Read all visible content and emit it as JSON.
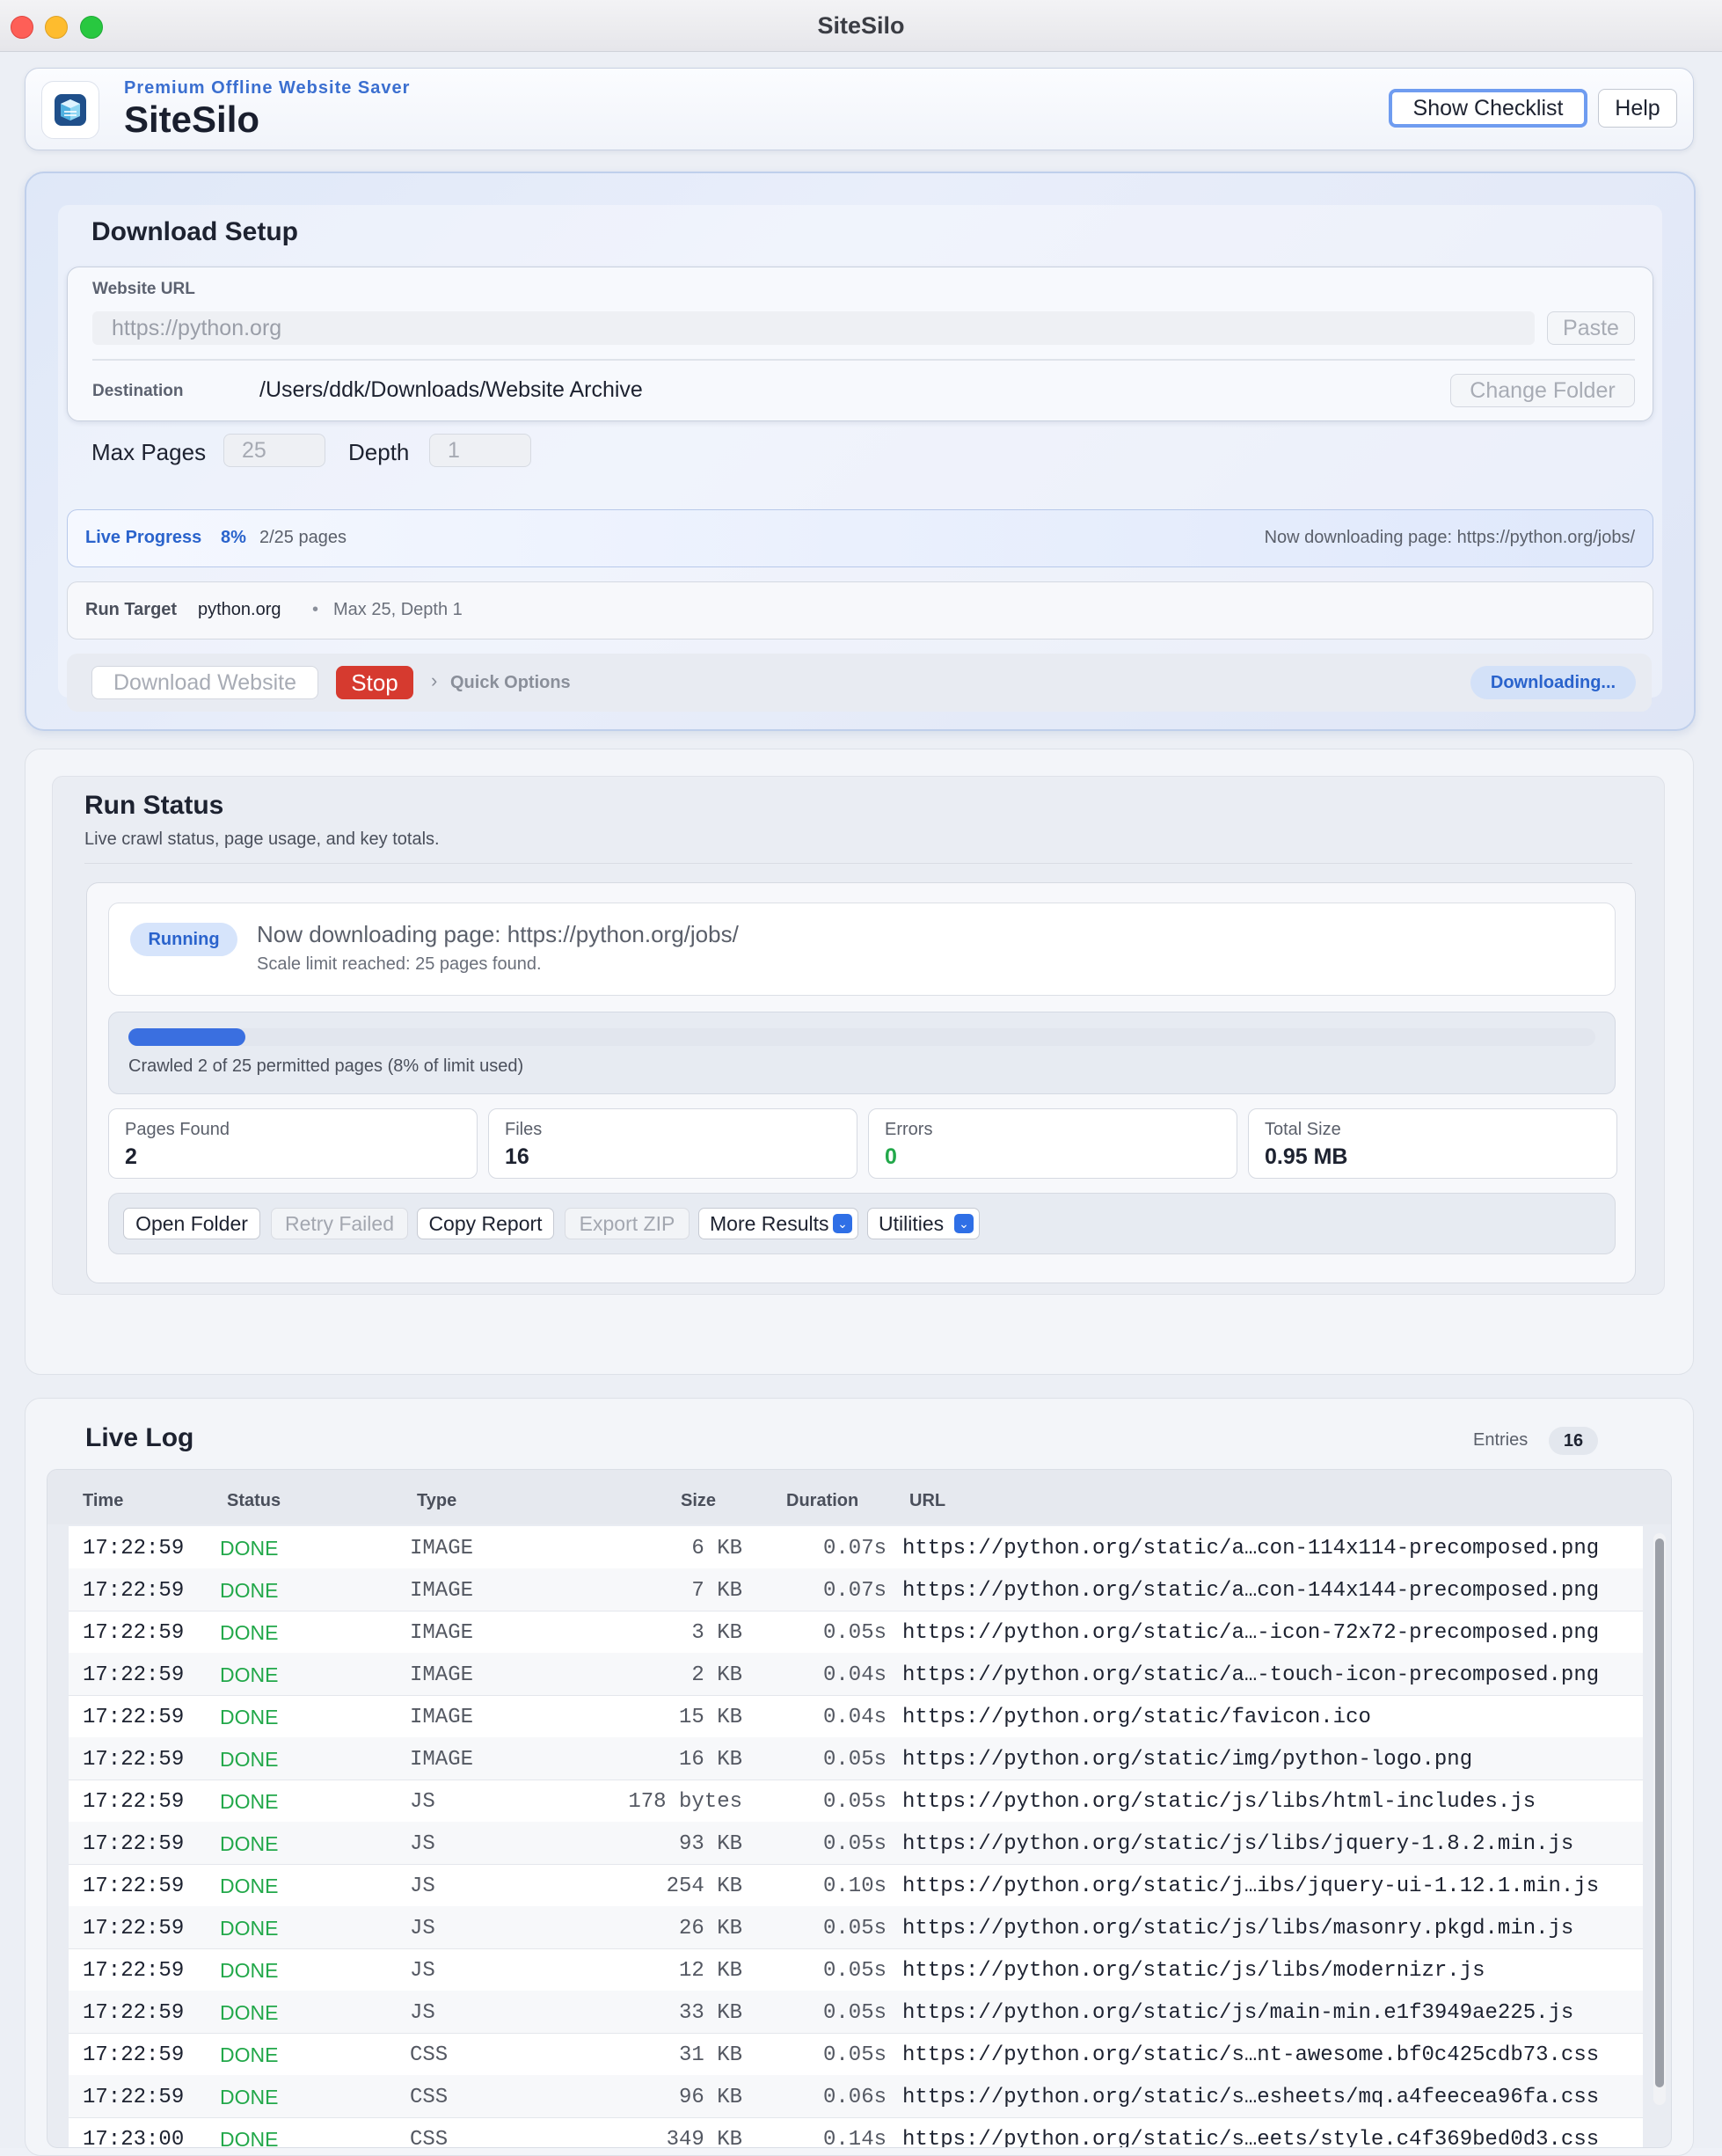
{
  "window": {
    "title": "SiteSilo"
  },
  "header": {
    "subtitle": "Premium Offline Website Saver",
    "app_name": "SiteSilo",
    "checklist_label": "Show Checklist",
    "help_label": "Help"
  },
  "setup": {
    "title": "Download Setup",
    "url_label": "Website URL",
    "url_placeholder": "https://python.org",
    "paste_label": "Paste",
    "destination_label": "Destination",
    "destination_path": "/Users/ddk/Downloads/Website Archive",
    "change_folder_label": "Change Folder",
    "max_pages_label": "Max Pages",
    "max_pages_value": "25",
    "depth_label": "Depth",
    "depth_value": "1",
    "progress": {
      "label": "Live Progress",
      "percent": "8%",
      "pages": "2/25 pages",
      "message": "Now downloading page: https://python.org/jobs/"
    },
    "run_target": {
      "label": "Run Target",
      "host": "python.org",
      "separator": "•",
      "limits": "Max 25, Depth 1"
    },
    "actions": {
      "download_label": "Download Website",
      "stop_label": "Stop",
      "quick_options_label": "Quick Options",
      "state_label": "Downloading..."
    }
  },
  "run_status": {
    "title": "Run Status",
    "subtitle": "Live crawl status, page usage, and key totals.",
    "state_badge": "Running",
    "message": "Now downloading page: https://python.org/jobs/",
    "submessage": "Scale limit reached: 25 pages found.",
    "progress_fraction": 0.08,
    "progress_text": "Crawled 2 of 25 permitted pages (8% of limit used)",
    "stats": [
      {
        "label": "Pages Found",
        "value": "2",
        "color": "#1d2230"
      },
      {
        "label": "Files",
        "value": "16",
        "color": "#1d2230"
      },
      {
        "label": "Errors",
        "value": "0",
        "color": "#22a84a"
      },
      {
        "label": "Total Size",
        "value": "0.95 MB",
        "color": "#1d2230"
      }
    ],
    "toolbar": {
      "open_folder": "Open Folder",
      "retry_failed": "Retry Failed",
      "copy_report": "Copy Report",
      "export_zip": "Export ZIP",
      "more_results": "More Results",
      "utilities": "Utilities"
    }
  },
  "live_log": {
    "title": "Live Log",
    "entries_label": "Entries",
    "entries_count": "16",
    "columns": [
      "Time",
      "Status",
      "Type",
      "Size",
      "Duration",
      "URL"
    ],
    "rows": [
      {
        "time": "17:22:59",
        "status": "DONE",
        "type": "IMAGE",
        "size": "6 KB",
        "duration": "0.07s",
        "url": "https://python.org/static/a…con-114x114-precomposed.png"
      },
      {
        "time": "17:22:59",
        "status": "DONE",
        "type": "IMAGE",
        "size": "7 KB",
        "duration": "0.07s",
        "url": "https://python.org/static/a…con-144x144-precomposed.png"
      },
      {
        "time": "17:22:59",
        "status": "DONE",
        "type": "IMAGE",
        "size": "3 KB",
        "duration": "0.05s",
        "url": "https://python.org/static/a…-icon-72x72-precomposed.png"
      },
      {
        "time": "17:22:59",
        "status": "DONE",
        "type": "IMAGE",
        "size": "2 KB",
        "duration": "0.04s",
        "url": "https://python.org/static/a…-touch-icon-precomposed.png"
      },
      {
        "time": "17:22:59",
        "status": "DONE",
        "type": "IMAGE",
        "size": "15 KB",
        "duration": "0.04s",
        "url": "https://python.org/static/favicon.ico"
      },
      {
        "time": "17:22:59",
        "status": "DONE",
        "type": "IMAGE",
        "size": "16 KB",
        "duration": "0.05s",
        "url": "https://python.org/static/img/python-logo.png"
      },
      {
        "time": "17:22:59",
        "status": "DONE",
        "type": "JS",
        "size": "178 bytes",
        "duration": "0.05s",
        "url": "https://python.org/static/js/libs/html-includes.js"
      },
      {
        "time": "17:22:59",
        "status": "DONE",
        "type": "JS",
        "size": "93 KB",
        "duration": "0.05s",
        "url": "https://python.org/static/js/libs/jquery-1.8.2.min.js"
      },
      {
        "time": "17:22:59",
        "status": "DONE",
        "type": "JS",
        "size": "254 KB",
        "duration": "0.10s",
        "url": "https://python.org/static/j…ibs/jquery-ui-1.12.1.min.js"
      },
      {
        "time": "17:22:59",
        "status": "DONE",
        "type": "JS",
        "size": "26 KB",
        "duration": "0.05s",
        "url": "https://python.org/static/js/libs/masonry.pkgd.min.js"
      },
      {
        "time": "17:22:59",
        "status": "DONE",
        "type": "JS",
        "size": "12 KB",
        "duration": "0.05s",
        "url": "https://python.org/static/js/libs/modernizr.js"
      },
      {
        "time": "17:22:59",
        "status": "DONE",
        "type": "JS",
        "size": "33 KB",
        "duration": "0.05s",
        "url": "https://python.org/static/js/main-min.e1f3949ae225.js"
      },
      {
        "time": "17:22:59",
        "status": "DONE",
        "type": "CSS",
        "size": "31 KB",
        "duration": "0.05s",
        "url": "https://python.org/static/s…nt-awesome.bf0c425cdb73.css"
      },
      {
        "time": "17:22:59",
        "status": "DONE",
        "type": "CSS",
        "size": "96 KB",
        "duration": "0.06s",
        "url": "https://python.org/static/s…esheets/mq.a4feecea96fa.css"
      },
      {
        "time": "17:23:00",
        "status": "DONE",
        "type": "CSS",
        "size": "349 KB",
        "duration": "0.14s",
        "url": "https://python.org/static/s…eets/style.c4f369bed0d3.css"
      }
    ]
  }
}
